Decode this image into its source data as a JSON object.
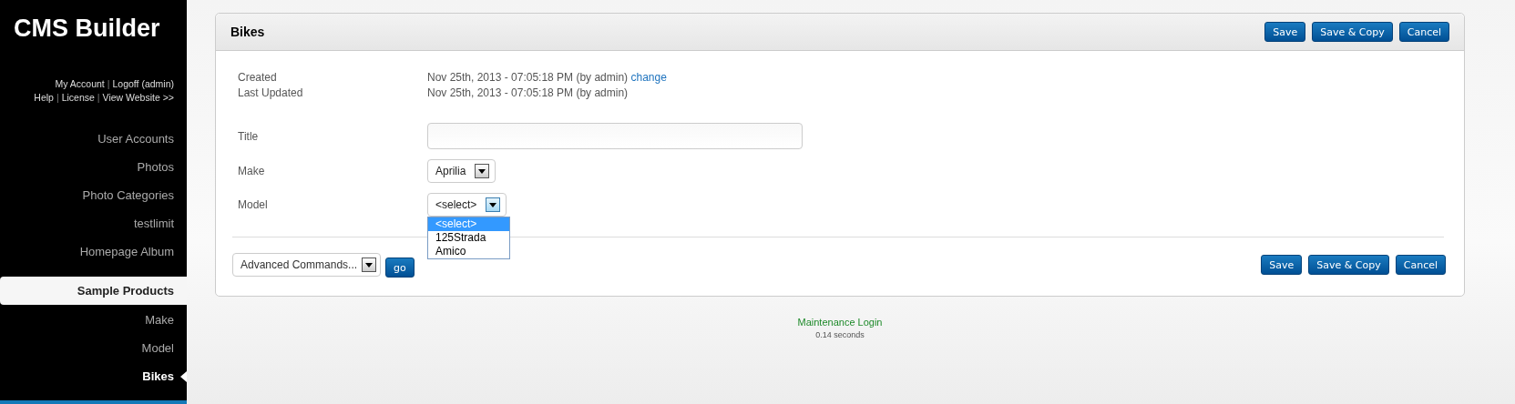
{
  "sidebar": {
    "logo": "CMS Builder",
    "account_links": [
      [
        {
          "text": "My Account",
          "kind": "link"
        },
        {
          "text": "|",
          "kind": "separator"
        },
        {
          "text": "Logoff (admin)",
          "kind": "link"
        }
      ],
      [
        {
          "text": "Help",
          "kind": "link"
        },
        {
          "text": "|",
          "kind": "separator"
        },
        {
          "text": "License",
          "kind": "link"
        },
        {
          "text": "|",
          "kind": "separator"
        },
        {
          "text": "View Website >>",
          "kind": "link"
        }
      ]
    ],
    "items": [
      {
        "label": "User Accounts",
        "kind": "link",
        "selected": false
      },
      {
        "label": "Photos",
        "kind": "link",
        "selected": false
      },
      {
        "label": "Photo Categories",
        "kind": "link",
        "selected": false
      },
      {
        "label": "testlimit",
        "kind": "link",
        "selected": false
      },
      {
        "label": "Homepage Album",
        "kind": "link",
        "selected": false
      },
      {
        "label": "Sample Products",
        "kind": "section",
        "selected": false
      },
      {
        "label": "Make",
        "kind": "link",
        "selected": false
      },
      {
        "label": "Model",
        "kind": "link",
        "selected": false
      },
      {
        "label": "Bikes",
        "kind": "link",
        "selected": true
      }
    ]
  },
  "panel": {
    "title": "Bikes",
    "buttons": [
      "Save",
      "Save & Copy",
      "Cancel"
    ],
    "info": [
      {
        "label": "Created",
        "value": "Nov 25th, 2013 - 07:05:18 PM (by admin)",
        "link": "change"
      },
      {
        "label": "Last Updated",
        "value": "Nov 25th, 2013 - 07:05:18 PM (by admin)"
      }
    ],
    "fields": [
      {
        "label": "Title",
        "kind": "text"
      },
      {
        "label": "Make",
        "kind": "select",
        "value": "Aprilia",
        "expanded": false
      },
      {
        "label": "Model",
        "kind": "select",
        "value": "<select>",
        "expanded": true,
        "options": [
          {
            "label": "<select>",
            "selected": true
          },
          {
            "label": "125Strada",
            "selected": false
          },
          {
            "label": "Amico",
            "selected": false
          }
        ]
      }
    ],
    "advanced_commands": "Advanced Commands...",
    "go_button": "go",
    "footer_buttons": [
      "Save",
      "Save & Copy",
      "Cancel"
    ]
  },
  "footer": {
    "link": "Maintenance Login",
    "timing": "0.14 seconds"
  }
}
